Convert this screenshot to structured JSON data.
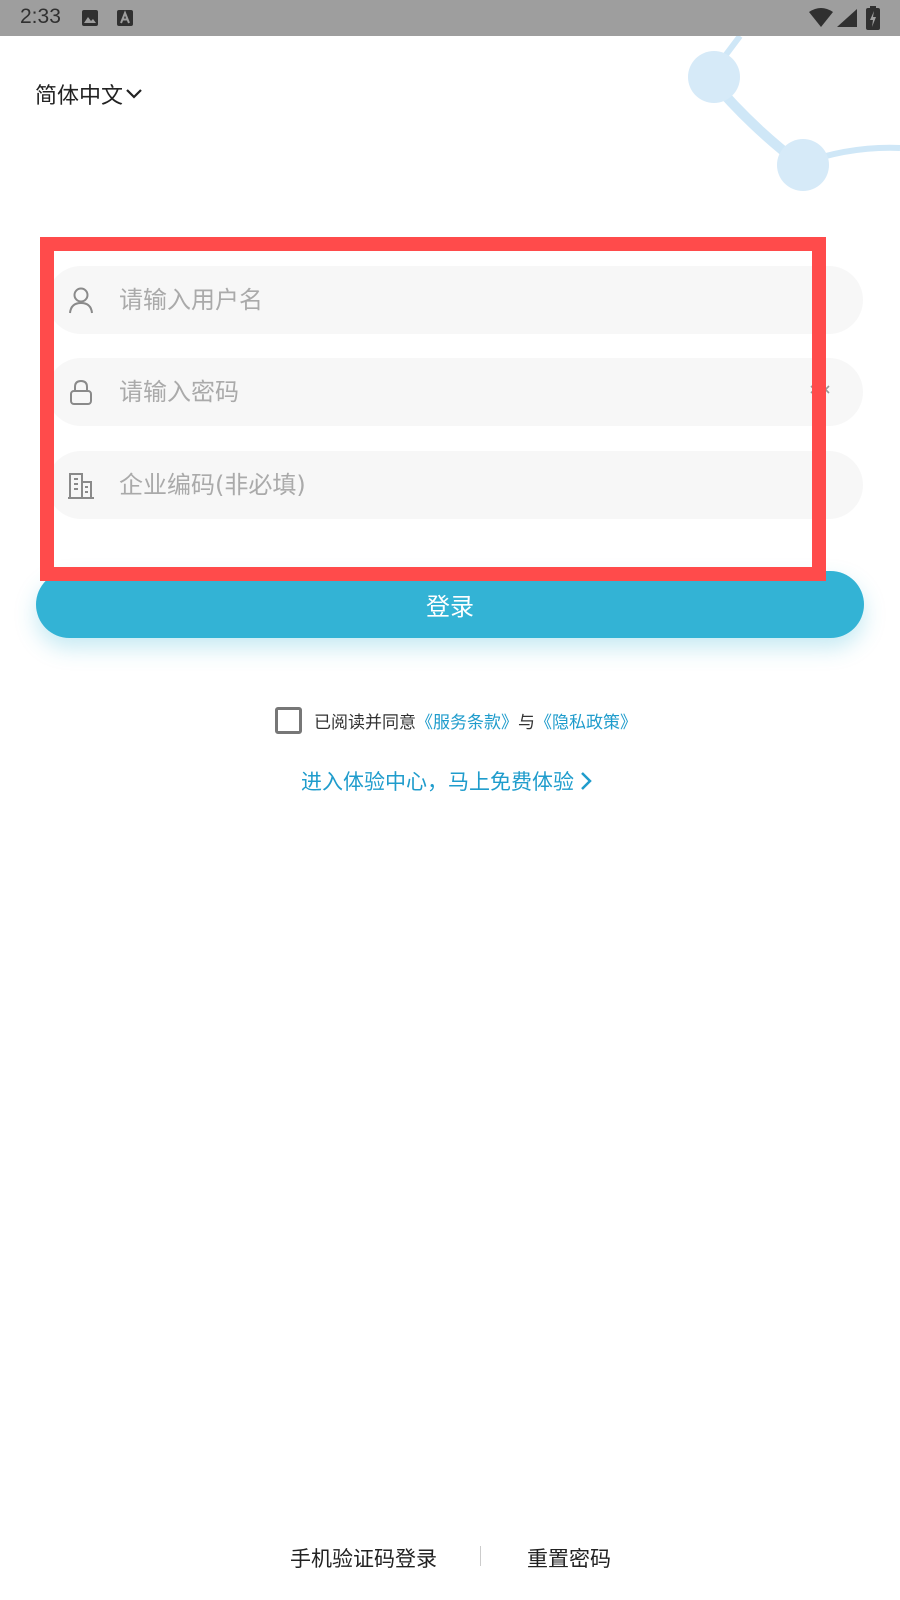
{
  "status_bar": {
    "time": "2:33",
    "icons": [
      "image-icon",
      "a-icon",
      "wifi-icon",
      "signal-icon",
      "battery-icon"
    ]
  },
  "language": {
    "label": "简体中文",
    "icon": "chevron-down-icon"
  },
  "form": {
    "username": {
      "placeholder": "请输入用户名",
      "value": "",
      "icon": "user-icon"
    },
    "password": {
      "placeholder": "请输入密码",
      "value": "",
      "icon": "lock-icon",
      "toggle_icon": "clear-icon"
    },
    "company": {
      "placeholder": "企业编码(非必填)",
      "value": "",
      "icon": "building-icon"
    }
  },
  "login_button": {
    "label": "登录"
  },
  "agreement": {
    "checked": false,
    "prefix": "已阅读并同意",
    "terms": "《服务条款》",
    "conjunction": "与",
    "privacy": "《隐私政策》"
  },
  "experience_link": {
    "label": "进入体验中心，马上免费体验",
    "icon": "chevron-right-icon"
  },
  "bottom": {
    "sms_login": "手机验证码登录",
    "reset_password": "重置密码"
  },
  "colors": {
    "accent": "#33b3d5",
    "link": "#1f9ccc",
    "highlight": "#ff4b4b",
    "input_bg": "#f7f7f7",
    "status_bar": "#9e9e9e"
  }
}
